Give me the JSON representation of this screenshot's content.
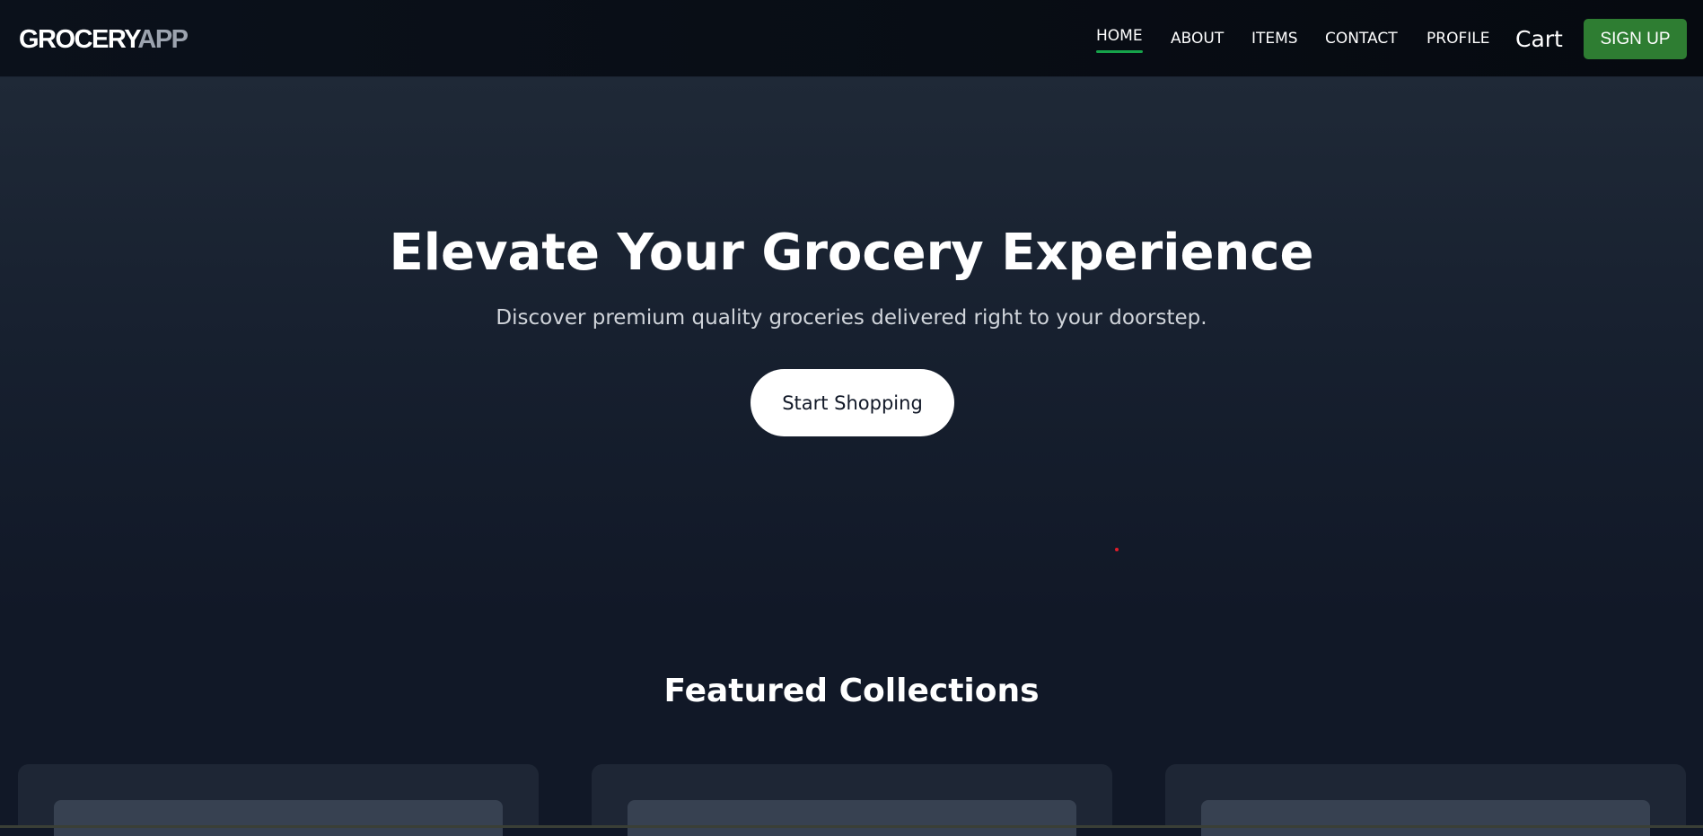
{
  "nav": {
    "logo_primary": "GROCERY",
    "logo_secondary": "APP",
    "links": [
      "HOME",
      "ABOUT",
      "ITEMS",
      "CONTACT",
      "PROFILE"
    ],
    "active_link": "HOME",
    "cart_label": "Cart",
    "signup_label": "SIGN UP"
  },
  "hero": {
    "title": "Elevate Your Grocery Experience",
    "subtitle": "Discover premium quality groceries delivered right to your doorstep.",
    "cta_label": "Start Shopping"
  },
  "featured": {
    "title": "Featured Collections",
    "card_count": 3
  },
  "colors": {
    "accent_green": "#2e7d32",
    "active_underline": "#16a34a",
    "background": "#111827",
    "card": "#1e2635",
    "card_image": "#374151"
  }
}
